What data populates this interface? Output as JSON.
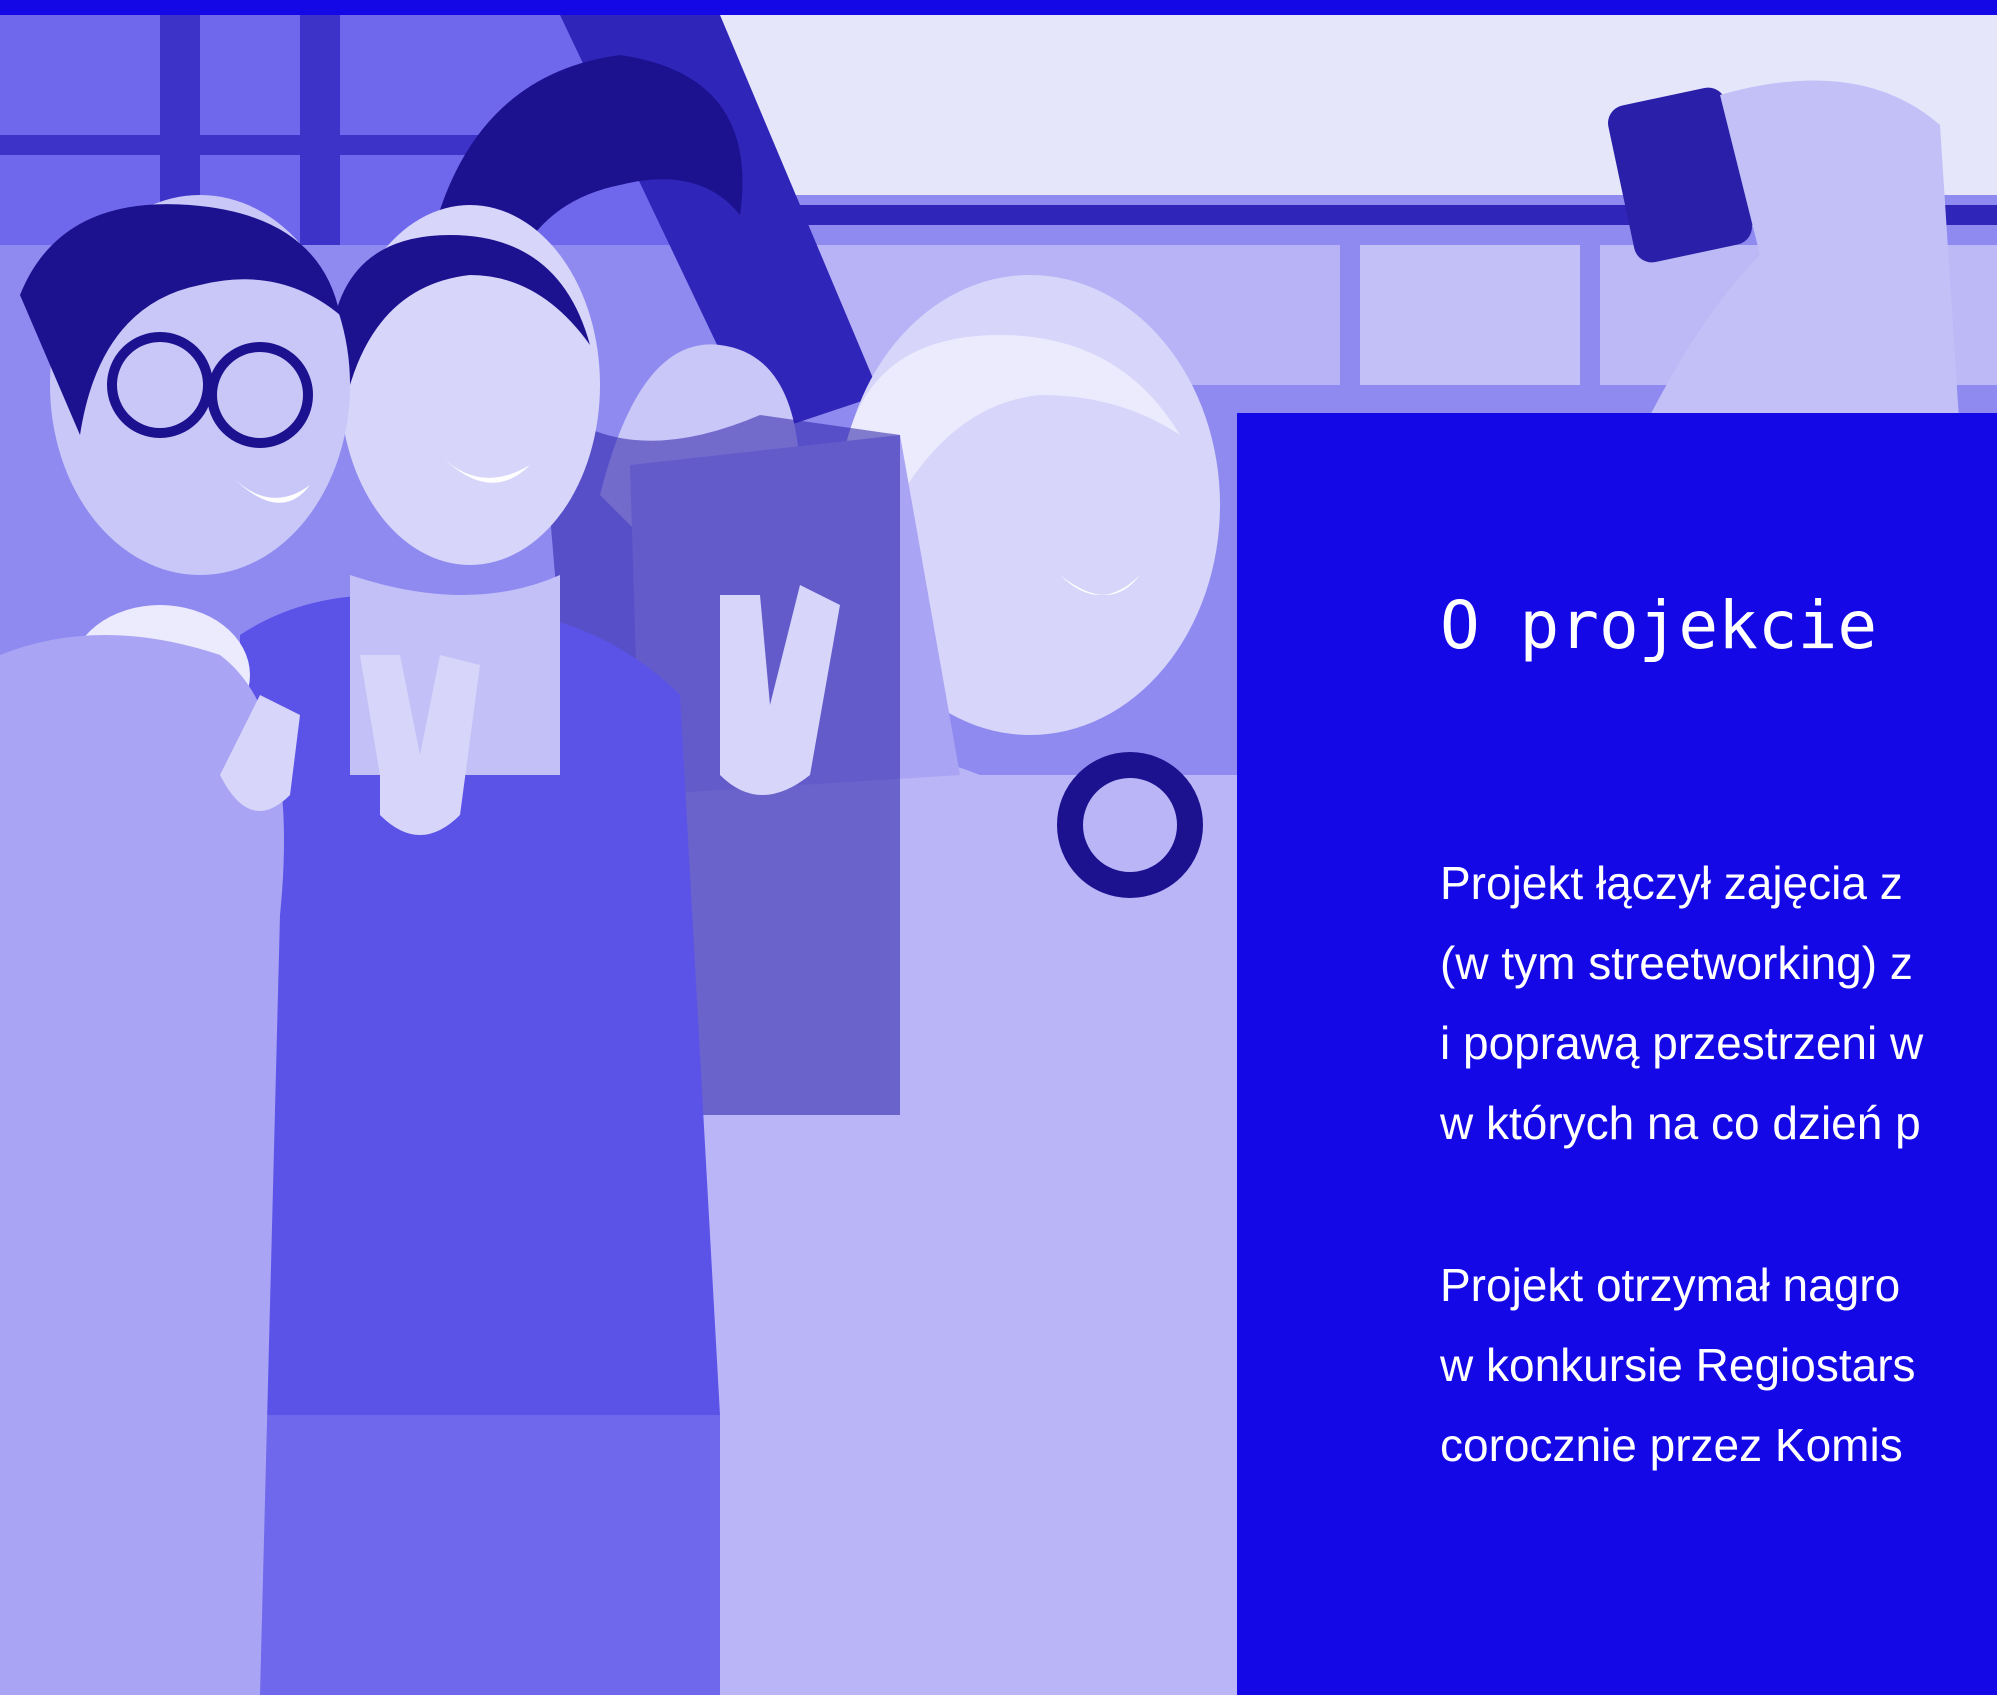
{
  "colors": {
    "brand_blue": "#1409e6",
    "photo_light": "#c9c8f5",
    "photo_mid": "#8b86ef",
    "photo_dark": "#3a2fc8"
  },
  "photo": {
    "subject": "four young people smiling and taking a selfie"
  },
  "panel": {
    "title": "O projekcie",
    "paragraph1": [
      "Projekt łączył zajęcia z",
      "(w tym streetworking) z",
      "i poprawą przestrzeni w",
      "w których na co dzień p"
    ],
    "paragraph2": [
      "Projekt otrzymał nagro",
      "w konkursie Regiostars",
      "corocznie przez Komis"
    ]
  }
}
